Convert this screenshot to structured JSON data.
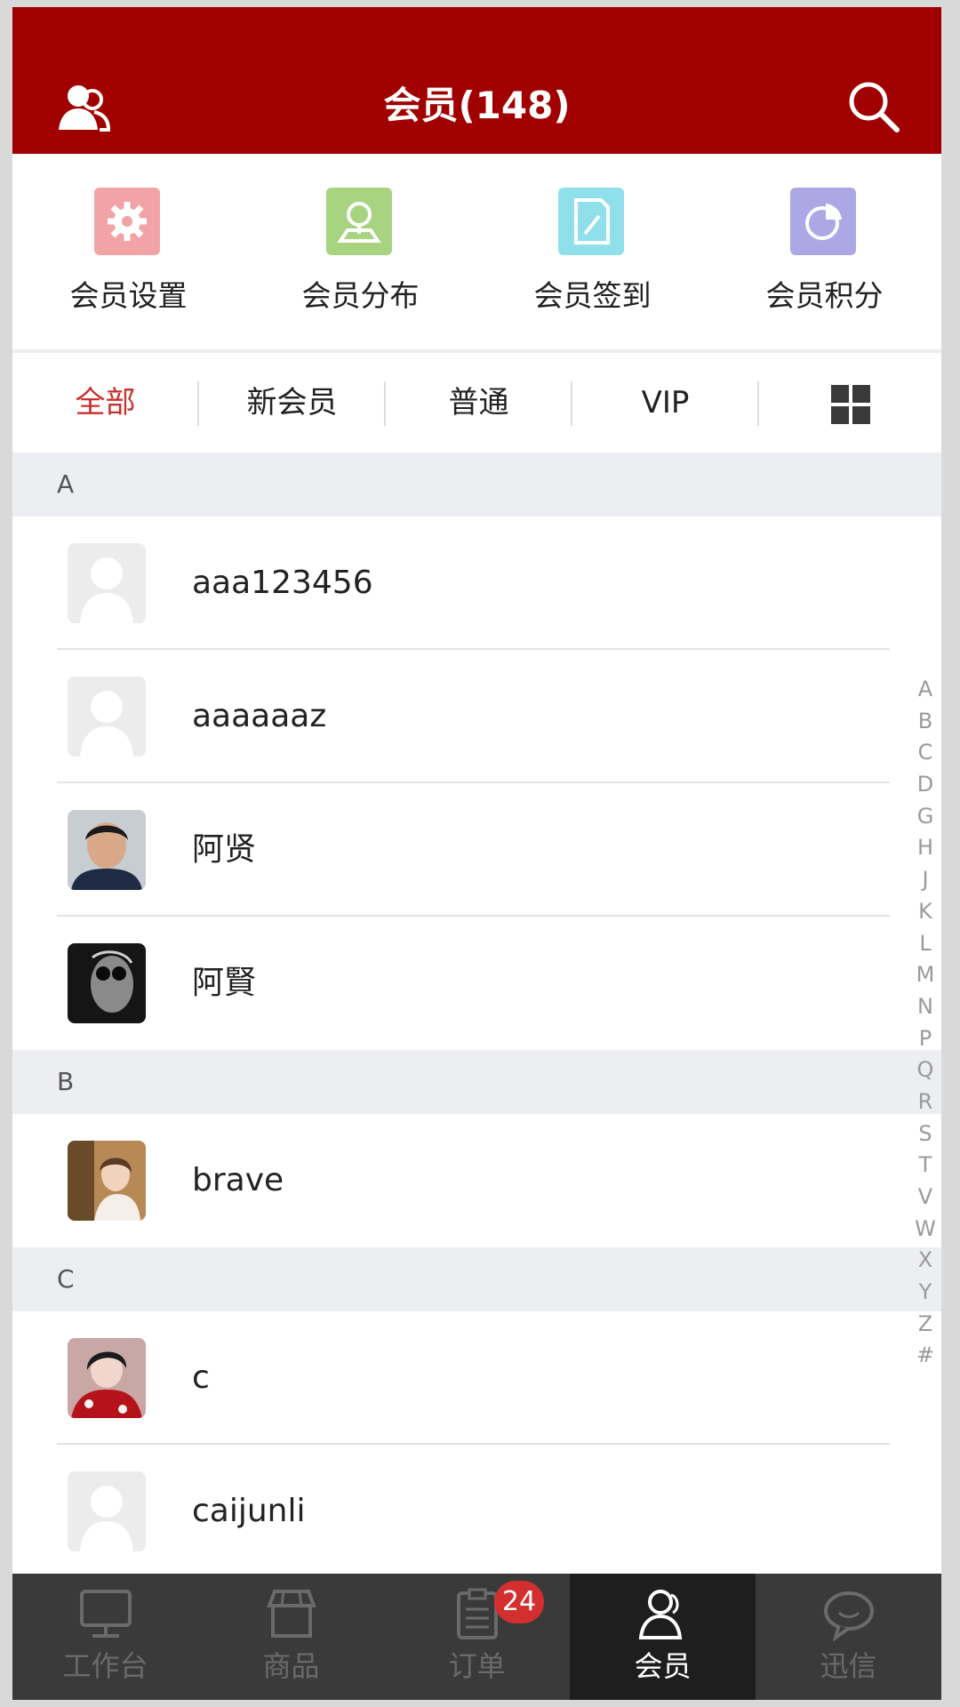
{
  "header": {
    "title": "会员(148)",
    "left_icon": "members-icon",
    "right_icon": "search-icon"
  },
  "actions": [
    {
      "label": "会员设置",
      "icon": "gear-icon",
      "color": "#f2a3a6"
    },
    {
      "label": "会员分布",
      "icon": "map-pin-icon",
      "color": "#a8d482"
    },
    {
      "label": "会员签到",
      "icon": "sign-in-icon",
      "color": "#8fe0ea"
    },
    {
      "label": "会员积分",
      "icon": "pie-chart-icon",
      "color": "#aea7e6"
    }
  ],
  "filters": {
    "all": "全部",
    "new": "新会员",
    "normal": "普通",
    "vip": "VIP",
    "grid_icon": "grid-icon"
  },
  "sections": [
    {
      "letter": "A",
      "members": [
        "aaa123456",
        "aaaaaaz",
        "阿贤",
        "阿賢"
      ]
    },
    {
      "letter": "B",
      "members": [
        "brave"
      ]
    },
    {
      "letter": "C",
      "members": [
        "c",
        "caijunli"
      ]
    }
  ],
  "index_letters": [
    "A",
    "B",
    "C",
    "D",
    "G",
    "H",
    "J",
    "K",
    "L",
    "M",
    "N",
    "P",
    "Q",
    "R",
    "S",
    "T",
    "V",
    "W",
    "X",
    "Y",
    "Z",
    "#"
  ],
  "tabs": [
    {
      "label": "工作台",
      "icon": "monitor-icon"
    },
    {
      "label": "商品",
      "icon": "store-icon"
    },
    {
      "label": "订单",
      "icon": "clipboard-icon",
      "badge": "24"
    },
    {
      "label": "会员",
      "icon": "member-icon"
    },
    {
      "label": "迅信",
      "icon": "chat-icon"
    }
  ],
  "colors": {
    "brand": "#a00000",
    "active_filter": "#c8302e",
    "tabbar": "#3a3a3a",
    "badge": "#d32f2f"
  }
}
